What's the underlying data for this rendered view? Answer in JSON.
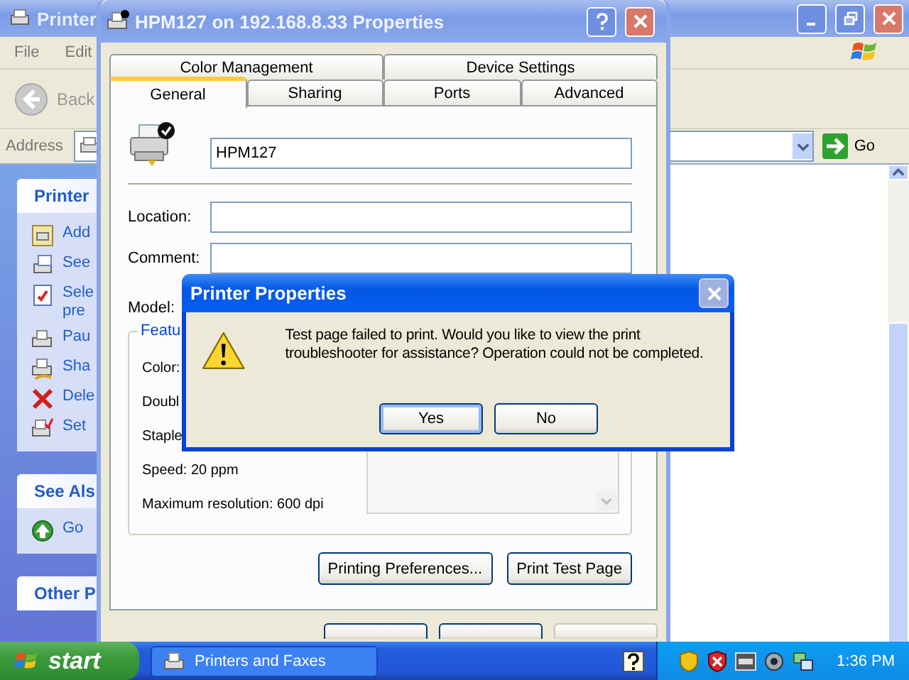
{
  "explorer": {
    "title": "Printer",
    "menu": [
      "File",
      "Edit"
    ],
    "back_label": "Back",
    "address_label": "Address",
    "go_label": "Go",
    "panels": [
      {
        "title": "Printer",
        "items": [
          {
            "kind": "add",
            "label": "Add"
          },
          {
            "kind": "queue",
            "label": "See"
          },
          {
            "kind": "document",
            "label": "Sele\npre"
          },
          {
            "kind": "printer",
            "label": "Pau"
          },
          {
            "kind": "share",
            "label": "Sha"
          },
          {
            "kind": "delete",
            "label": "Dele"
          },
          {
            "kind": "check",
            "label": "Set"
          }
        ]
      },
      {
        "title": "See Als",
        "items": [
          {
            "kind": "globe",
            "label": "Go"
          }
        ]
      },
      {
        "title": "Other P"
      }
    ]
  },
  "properties_dialog": {
    "title": "HPM127 on 192.168.8.33 Properties",
    "tab_rows": [
      {
        "tabs": [
          {
            "label": "Color Management",
            "selected": false
          },
          {
            "label": "Device Settings",
            "selected": false
          }
        ]
      },
      {
        "tabs": [
          {
            "label": "General",
            "selected": true
          },
          {
            "label": "Sharing",
            "selected": false
          },
          {
            "label": "Ports",
            "selected": false
          },
          {
            "label": "Advanced",
            "selected": false
          }
        ]
      }
    ],
    "printer_name": "HPM127",
    "fields": [
      {
        "label": "Location:"
      },
      {
        "label": "Comment:"
      }
    ],
    "model_label": "Model:",
    "features": {
      "legend": "Featu",
      "lines": [
        "Color:",
        "Doubl",
        "Staple",
        "Speed: 20 ppm",
        "Maximum resolution: 600 dpi"
      ]
    },
    "buttons": [
      "Printing Preferences...",
      "Print Test Page"
    ]
  },
  "message_box": {
    "title": "Printer Properties",
    "close_disabled": true,
    "message": "Test page failed to print. Would you like to view the print troubleshooter for assistance? Operation could not be completed.",
    "buttons": [
      {
        "label": "Yes",
        "default": true
      },
      {
        "label": "No",
        "default": false
      }
    ]
  },
  "taskbar": {
    "start_label": "start",
    "tasks": [
      {
        "label": "Printers and Faxes",
        "selected": false
      }
    ],
    "clock": "1:36 PM"
  }
}
